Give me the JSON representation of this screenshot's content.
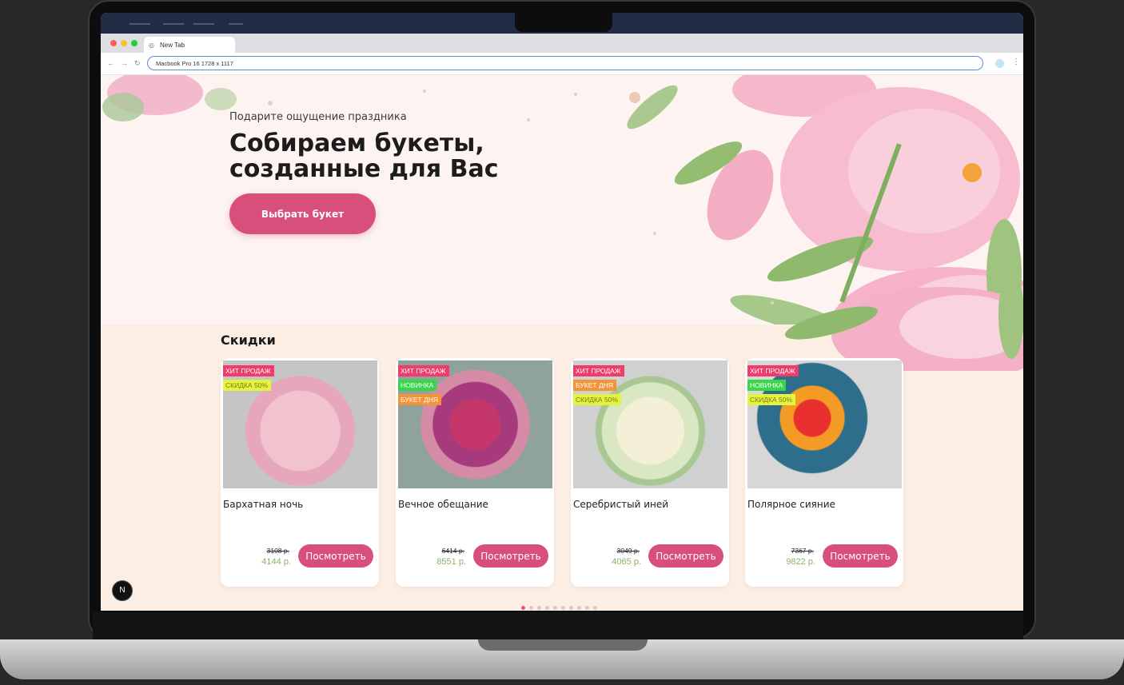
{
  "browser": {
    "apple_glyph": "",
    "tab_title": "New Tab",
    "url_text": "Macbook Pro 16   1728 x 1117"
  },
  "hero": {
    "kicker": "Подарите ощущение праздника",
    "title_line1": "Собираем букеты,",
    "title_line2": "созданные для Вас",
    "cta_label": "Выбрать букет"
  },
  "discounts": {
    "title": "Скидки",
    "products": [
      {
        "name": "Бархатная ночь",
        "old_price": "3108 р.",
        "price": "4144 р.",
        "button": "Посмотреть",
        "badges": [
          {
            "text": "хит продаж",
            "color": "#ee3d6d"
          },
          {
            "text": "скидка 50%",
            "color": "#e4f33d",
            "text_color": "#7a7a1a"
          }
        ]
      },
      {
        "name": "Вечное обещание",
        "old_price": "6414 р.",
        "price": "8551 р.",
        "button": "Посмотреть",
        "badges": [
          {
            "text": "хит продаж",
            "color": "#ee3d6d"
          },
          {
            "text": "новинка",
            "color": "#39d64c"
          },
          {
            "text": "букет дня",
            "color": "#f49338"
          }
        ]
      },
      {
        "name": "Серебристый иней",
        "old_price": "3049 р.",
        "price": "4065 р.",
        "button": "Посмотреть",
        "badges": [
          {
            "text": "хит продаж",
            "color": "#ee3d6d"
          },
          {
            "text": "букет дня",
            "color": "#f49338"
          },
          {
            "text": "скидка 50%",
            "color": "#e4f33d",
            "text_color": "#7a7a1a"
          }
        ]
      },
      {
        "name": "Полярное сияние",
        "old_price": "7367 р.",
        "price": "9822 р.",
        "button": "Посмотреть",
        "badges": [
          {
            "text": "хит продаж",
            "color": "#ee3d6d"
          },
          {
            "text": "новинка",
            "color": "#39d64c"
          },
          {
            "text": "скидка 50%",
            "color": "#e4f33d",
            "text_color": "#7a7a1a"
          }
        ]
      }
    ]
  },
  "carousel": {
    "pages": 10,
    "active": 0
  },
  "corner_badge": "N",
  "colors": {
    "accent": "#d84f7b",
    "hero_bg": "#fdf3f1",
    "section_bg": "#fdeee4",
    "price_green": "#8bb268"
  }
}
